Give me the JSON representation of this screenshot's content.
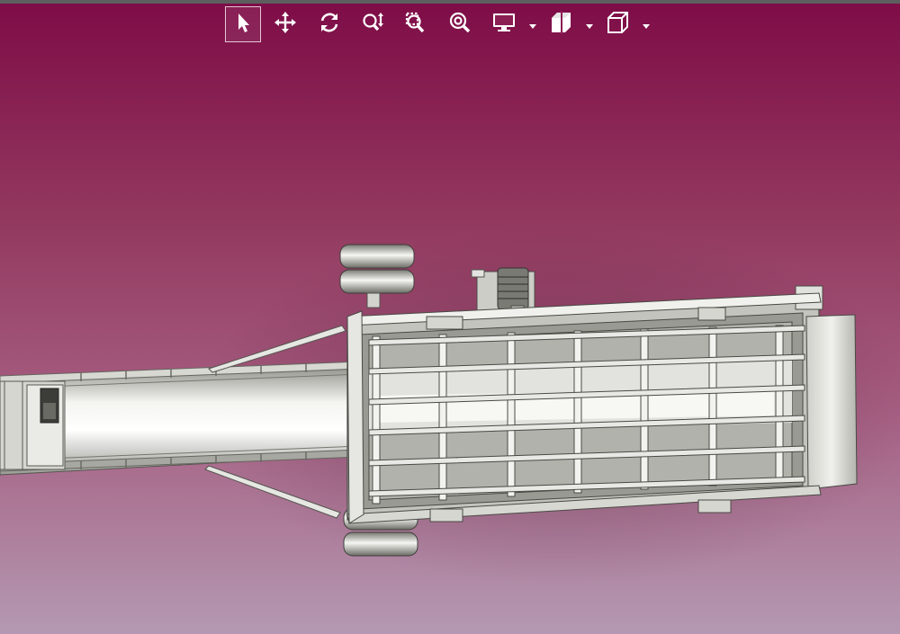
{
  "toolbar": {
    "tools": [
      {
        "id": "select",
        "icon": "select-arrow-icon",
        "active": true
      },
      {
        "id": "pan",
        "icon": "pan-move-icon",
        "active": false
      },
      {
        "id": "rotate",
        "icon": "rotate-icon",
        "active": false
      },
      {
        "id": "zoom",
        "icon": "zoom-updown-icon",
        "active": false
      },
      {
        "id": "zoom-window",
        "icon": "zoom-window-icon",
        "active": false
      },
      {
        "id": "zoom-fit",
        "icon": "zoom-fit-icon",
        "active": false
      },
      {
        "id": "display",
        "icon": "display-monitor-icon",
        "active": false,
        "dropdown": true
      },
      {
        "id": "section",
        "icon": "section-cut-icon",
        "active": false,
        "dropdown": true
      },
      {
        "id": "view-cube",
        "icon": "view-cube-icon",
        "active": false,
        "dropdown": true
      }
    ]
  },
  "viewport": {
    "model": "conveyor-assembly",
    "colors": {
      "background_top": "#7e0c47",
      "background_bottom": "#b499b2",
      "toolbar_icon": "#ffffff",
      "model_light": "#f2f2ee",
      "model_mid": "#bdbdb6",
      "model_dark": "#6f6f6a"
    }
  }
}
